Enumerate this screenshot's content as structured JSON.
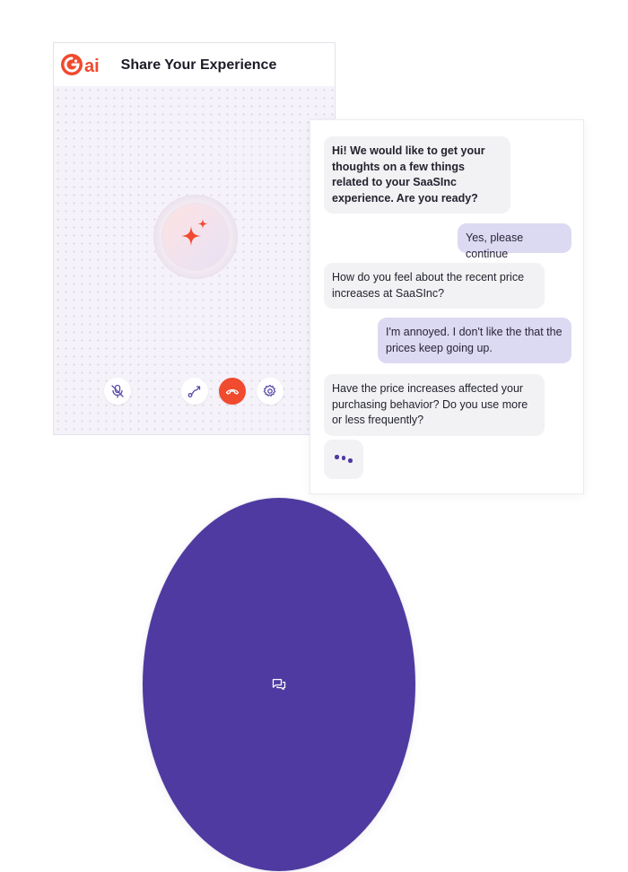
{
  "app": {
    "logo_text": "ai",
    "title": "Share Your Experience",
    "colors": {
      "brand": "#f04a2f",
      "accent": "#4e3aa0",
      "user_bubble": "#dcd9f2",
      "bot_bubble": "#f2f2f4"
    }
  },
  "controls": [
    {
      "name": "mute-button",
      "icon": "mic-off-icon",
      "active": false
    },
    {
      "name": "chat-toggle-button",
      "icon": "chat-bubbles-icon",
      "active": true
    },
    {
      "name": "route-button",
      "icon": "route-path-icon",
      "active": false
    },
    {
      "name": "end-call-button",
      "icon": "phone-hangup-icon",
      "active": false
    },
    {
      "name": "settings-button",
      "icon": "gear-icon",
      "active": false
    }
  ],
  "messages": [
    {
      "role": "bot",
      "text": "Hi! We would like to get your thoughts on a few things related to your SaaSInc experience. Are you ready?"
    },
    {
      "role": "user",
      "text": "Yes, please continue"
    },
    {
      "role": "bot",
      "text": "How do you feel about the recent price increases at SaaSInc?"
    },
    {
      "role": "user",
      "text": "I'm annoyed. I don't like the that the prices keep going up."
    },
    {
      "role": "bot",
      "text": "Have the price increases affected your purchasing behavior? Do you use more or less frequently?"
    }
  ],
  "typing_indicator": {
    "icon": "typing-dots-icon"
  }
}
